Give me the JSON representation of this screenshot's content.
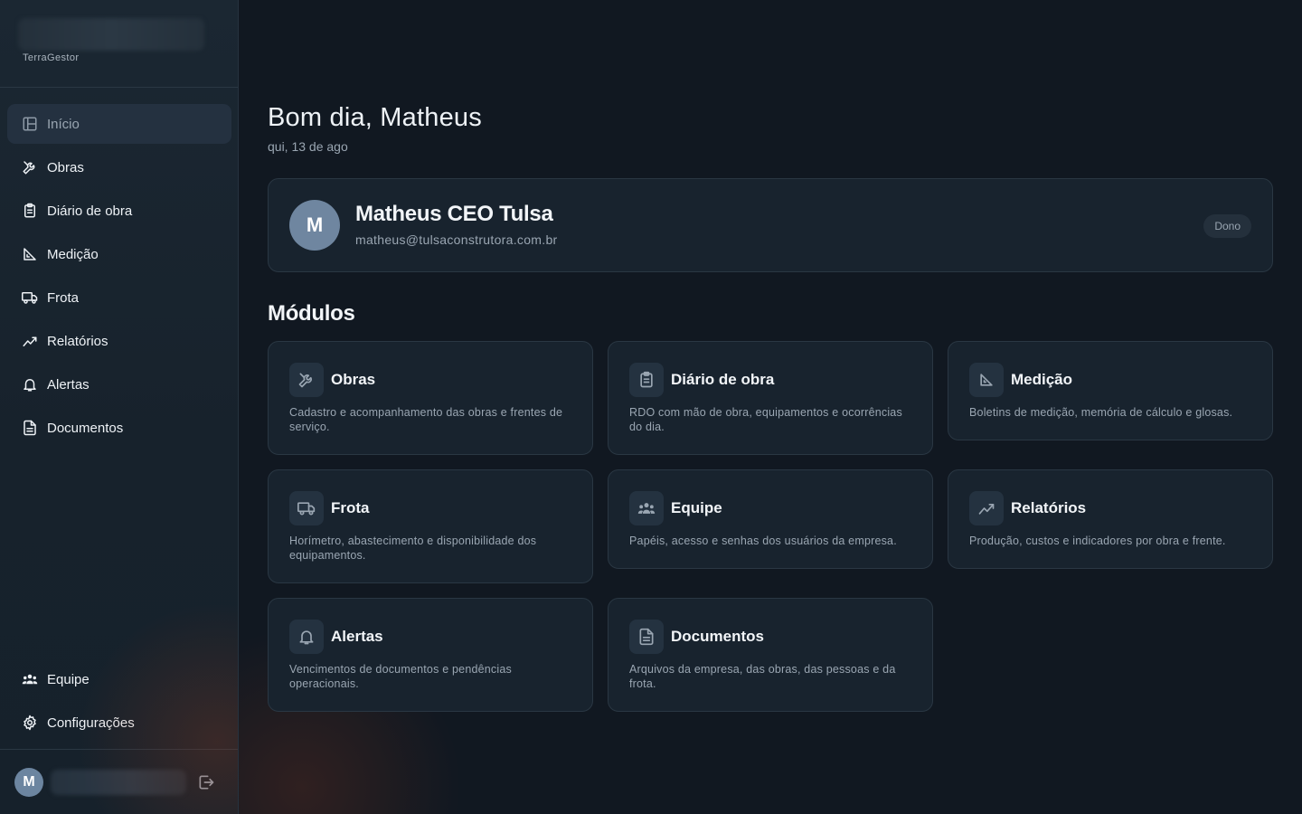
{
  "brand": {
    "name": "TerraGestor"
  },
  "sidebar": {
    "items": [
      {
        "label": "Início",
        "icon": "layout-icon",
        "active": true
      },
      {
        "label": "Obras",
        "icon": "tools-icon"
      },
      {
        "label": "Diário de obra",
        "icon": "clipboard-icon"
      },
      {
        "label": "Medição",
        "icon": "ruler-triangle-icon"
      },
      {
        "label": "Frota",
        "icon": "truck-icon"
      },
      {
        "label": "Relatórios",
        "icon": "trend-chart-icon"
      },
      {
        "label": "Alertas",
        "icon": "bell-icon"
      },
      {
        "label": "Documentos",
        "icon": "document-icon"
      }
    ],
    "bottom_items": [
      {
        "label": "Equipe",
        "icon": "users-icon"
      },
      {
        "label": "Configurações",
        "icon": "gear-icon"
      }
    ],
    "user": {
      "avatar_initial": "M"
    }
  },
  "main": {
    "greeting": "Bom dia, Matheus",
    "date": "qui, 13 de ago",
    "profile": {
      "avatar_initial": "M",
      "name": "Matheus CEO Tulsa",
      "email": "matheus@tulsaconstrutora.com.br",
      "role": "Dono"
    },
    "modules_title": "Módulos",
    "modules": [
      {
        "title": "Obras",
        "icon": "tools-icon",
        "description": "Cadastro e acompanhamento das obras e frentes de serviço."
      },
      {
        "title": "Diário de obra",
        "icon": "clipboard-icon",
        "description": "RDO com mão de obra, equipamentos e ocorrências do dia."
      },
      {
        "title": "Medição",
        "icon": "ruler-triangle-icon",
        "description": "Boletins de medição, memória de cálculo e glosas."
      },
      {
        "title": "Frota",
        "icon": "truck-icon",
        "description": "Horímetro, abastecimento e disponibilidade dos equipamentos."
      },
      {
        "title": "Equipe",
        "icon": "users-icon",
        "description": "Papéis, acesso e senhas dos usuários da empresa."
      },
      {
        "title": "Relatórios",
        "icon": "trend-chart-icon",
        "description": "Produção, custos e indicadores por obra e frente."
      },
      {
        "title": "Alertas",
        "icon": "bell-icon",
        "description": "Vencimentos de documentos e pendências operacionais."
      },
      {
        "title": "Documentos",
        "icon": "document-icon",
        "description": "Arquivos da empresa, das obras, das pessoas e da frota."
      }
    ]
  },
  "colors": {
    "background": "#111821",
    "sidebar": "#1b2732",
    "card": "#18232e",
    "accent_avatar": "#6f86a0"
  }
}
